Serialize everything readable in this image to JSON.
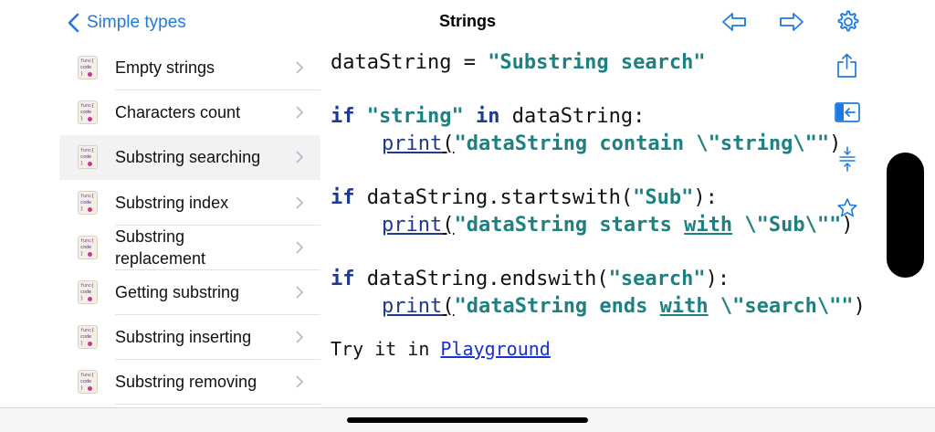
{
  "nav": {
    "back_label": "Simple types",
    "title": "Strings"
  },
  "sidebar": {
    "items": [
      {
        "label": "Empty strings"
      },
      {
        "label": "Characters count"
      },
      {
        "label": "Substring searching",
        "selected": true
      },
      {
        "label": "Substring index"
      },
      {
        "label": "Substring replacement"
      },
      {
        "label": "Getting substring"
      },
      {
        "label": "Substring inserting"
      },
      {
        "label": "Substring removing"
      }
    ],
    "icon_lines": [
      "func{",
      "code",
      "}"
    ]
  },
  "code": {
    "line1": {
      "a": "dataString = ",
      "b": "\"Substring search\""
    },
    "line2": {
      "kw1": "if ",
      "str": "\"string\"",
      "kw2": " in",
      "rest": " dataString:"
    },
    "line3": {
      "fn": "print",
      "p": "(",
      "str": "\"dataString contain \\\"string\\\"\"",
      "close": ")"
    },
    "line4": {
      "kw": "if",
      "rest": " dataString.startswith(",
      "str": "\"Sub\"",
      "close": "):"
    },
    "line5": {
      "fn": "print",
      "p": "(",
      "s1": "\"dataString starts ",
      "u": "with",
      "s2": " \\\"Sub\\\"\"",
      "close": ")"
    },
    "line6": {
      "kw": "if",
      "rest": " dataString.endswith(",
      "str": "\"search\"",
      "close": "):"
    },
    "line7": {
      "fn": "print",
      "p": "(",
      "s1": "\"dataString ends ",
      "u": "with",
      "s2": " \\\"search\\\"\"",
      "close": ")"
    }
  },
  "try": {
    "prefix": "Try it in ",
    "link": "Playground"
  },
  "colors": {
    "accent": "#1f7ae0",
    "keyword": "#1d3a8f",
    "string": "#1e8080",
    "link": "#1a31d6",
    "selected_row": "#f2f2f4"
  },
  "icons": {
    "toolbar": [
      "arrow-left-icon",
      "arrow-right-icon",
      "gear-icon"
    ],
    "side": [
      "share-icon",
      "sidebar-toggle-icon",
      "font-size-icon",
      "star-icon"
    ]
  }
}
